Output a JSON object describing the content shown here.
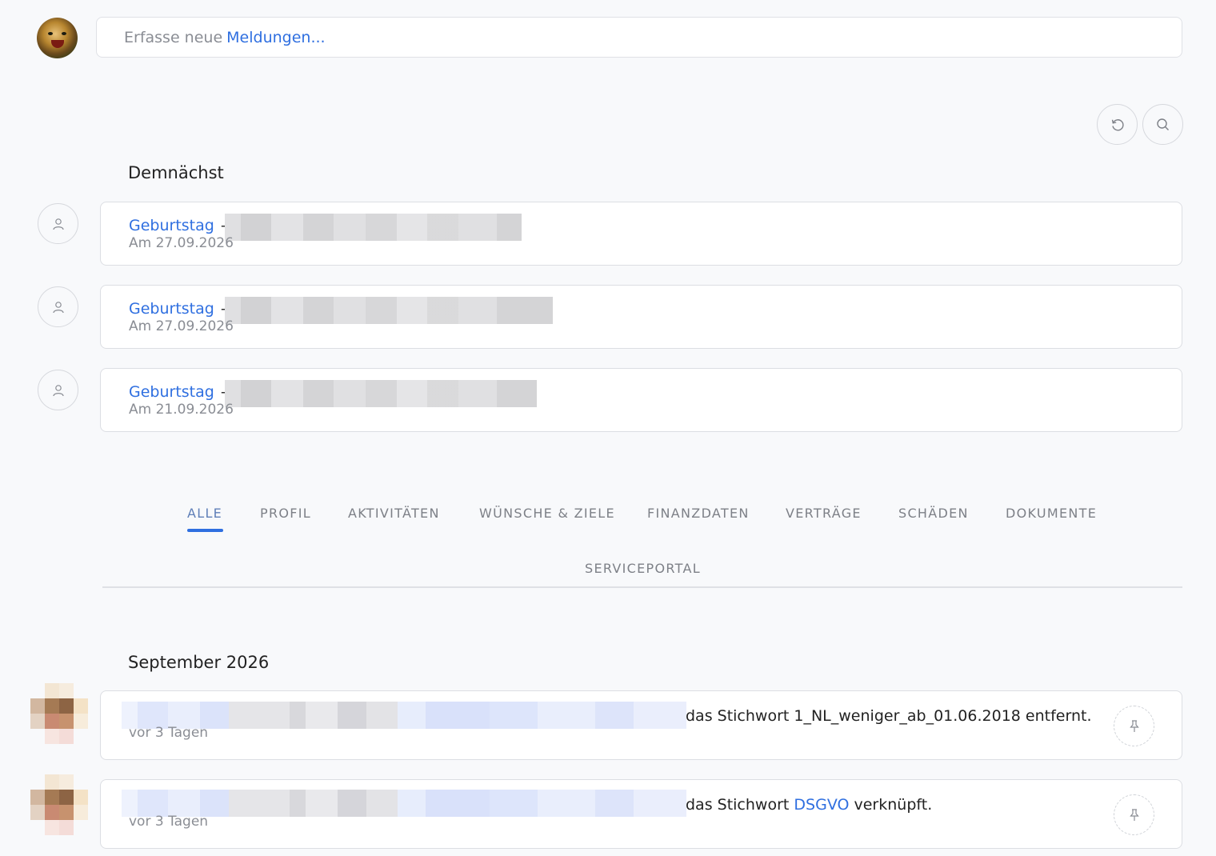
{
  "composer": {
    "prefix": "Erfasse neue",
    "link": "Meldungen..."
  },
  "toolbar": {
    "refresh_icon": "refresh-icon",
    "search_icon": "search-icon"
  },
  "upcoming": {
    "title": "Demnächst",
    "items": [
      {
        "type": "Geburtstag",
        "separator": "-",
        "date": "Am 27.09.2026"
      },
      {
        "type": "Geburtstag",
        "separator": "-",
        "date": "Am 27.09.2026"
      },
      {
        "type": "Geburtstag",
        "separator": "-",
        "date": "Am 21.09.2026"
      }
    ]
  },
  "tabs": [
    {
      "label": "ALLE",
      "active": true
    },
    {
      "label": "PROFIL"
    },
    {
      "label": "AKTIVITÄTEN"
    },
    {
      "label": "WÜNSCHE & ZIELE"
    },
    {
      "label": "FINANZDATEN"
    },
    {
      "label": "VERTRÄGE"
    },
    {
      "label": "SCHÄDEN"
    },
    {
      "label": "DOKUMENTE"
    },
    {
      "label": "SERVICEPORTAL"
    }
  ],
  "feed": {
    "month": "September 2026",
    "items": [
      {
        "text": "das Stichwort 1_NL_weniger_ab_01.06.2018 entfernt.",
        "time": "vor 3 Tagen"
      },
      {
        "text_before": "das Stichwort",
        "link": "DSGVO",
        "text_after": "verknüpft.",
        "time": "vor 3 Tagen"
      }
    ]
  },
  "colors": {
    "accent": "#2f6fe0",
    "background": "#f8f9fb",
    "muted_text": "#8a8d94"
  }
}
